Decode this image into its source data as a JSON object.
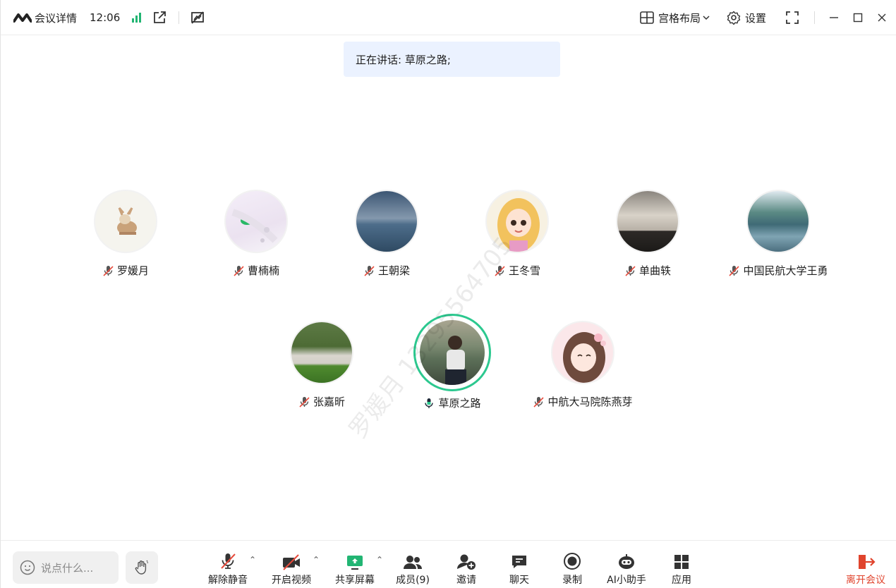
{
  "titlebar": {
    "meeting_details": "会议详情",
    "time": "12:06",
    "layout_label": "宫格布局",
    "settings_label": "设置"
  },
  "banner": {
    "speaking_text": "正在讲话: 草原之路;"
  },
  "watermark": "罗媛月 13295564705",
  "participants": [
    {
      "name": "罗媛月",
      "muted": true
    },
    {
      "name": "曹楠楠",
      "muted": true
    },
    {
      "name": "王朝梁",
      "muted": true
    },
    {
      "name": "王冬雪",
      "muted": true
    },
    {
      "name": "单曲轶",
      "muted": true
    },
    {
      "name": "中国民航大学王勇",
      "muted": true
    },
    {
      "name": "张嘉昕",
      "muted": true
    },
    {
      "name": "草原之路",
      "muted": false,
      "speaking": true
    },
    {
      "name": "中航大马院陈燕芽",
      "muted": true
    }
  ],
  "toolbar": {
    "chat_placeholder": "说点什么...",
    "unmute": "解除静音",
    "start_video": "开启视频",
    "share_screen": "共享屏幕",
    "members": "成员(9)",
    "invite": "邀请",
    "chat": "聊天",
    "record": "录制",
    "ai_assistant": "AI小助手",
    "apps": "应用",
    "leave": "离开会议"
  },
  "colors": {
    "accent_green": "#2cc88f",
    "banner_bg": "#ebf2ff",
    "leave_red": "#e0442d",
    "mute_red": "#e64b3c"
  }
}
